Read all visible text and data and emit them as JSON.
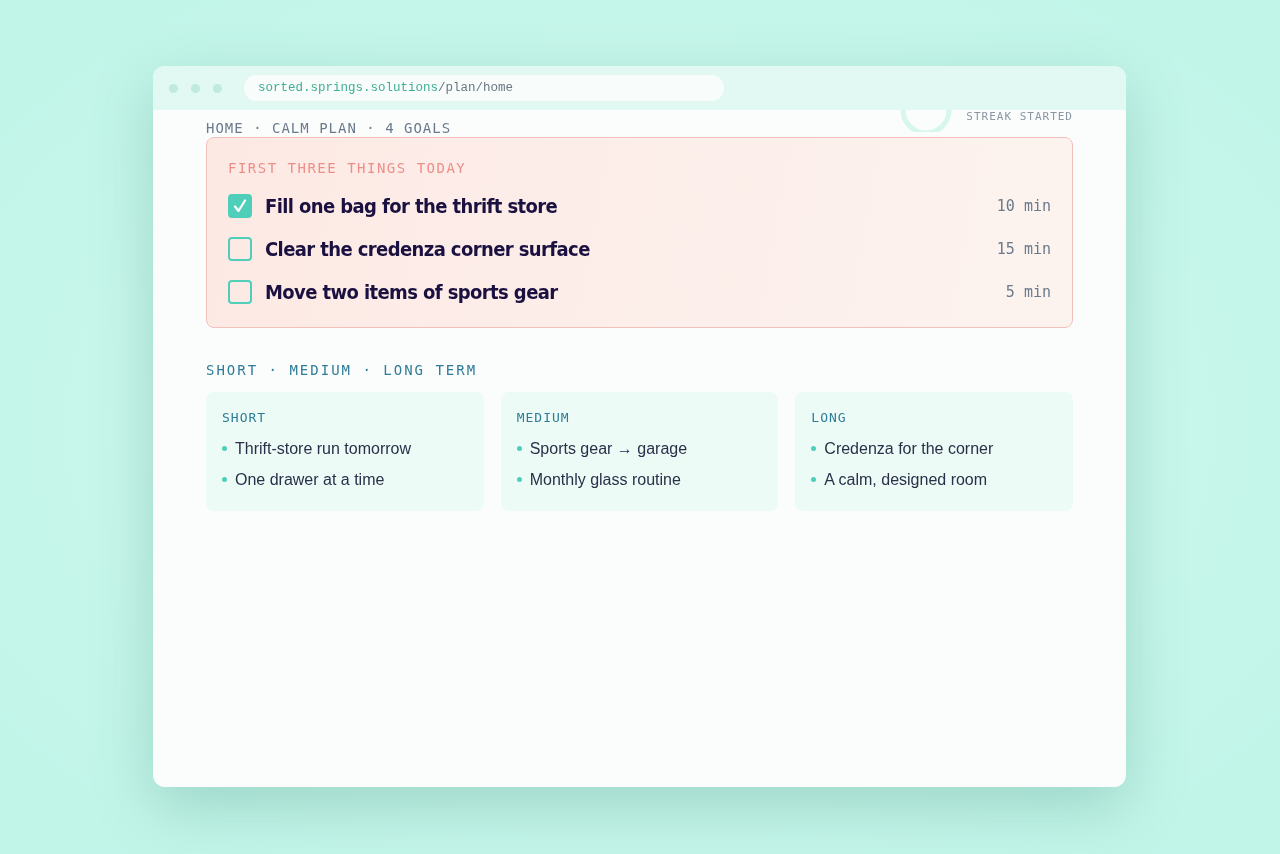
{
  "browser": {
    "url_host": "sorted.springs.solutions",
    "url_path": "/plan/home"
  },
  "header": {
    "breadcrumb": "HOME · CALM PLAN · 4 GOALS",
    "streak_label": "STREAK STARTED"
  },
  "today": {
    "title": "FIRST THREE THINGS TODAY",
    "tasks": [
      {
        "label": "Fill one bag for the thrift store",
        "duration": "10 min",
        "checked": true
      },
      {
        "label": "Clear the credenza corner surface",
        "duration": "15 min",
        "checked": false
      },
      {
        "label": "Move two items of sports gear",
        "duration": "5 min",
        "checked": false
      }
    ]
  },
  "terms": {
    "title": "SHORT · MEDIUM · LONG TERM",
    "columns": [
      {
        "heading": "SHORT",
        "items": [
          "Thrift-store run tomorrow",
          "One drawer at a time"
        ]
      },
      {
        "heading": "MEDIUM",
        "items": [
          "Sports gear → garage",
          "Monthly glass routine"
        ]
      },
      {
        "heading": "LONG",
        "items": [
          "Credenza for the corner",
          "A calm, designed room"
        ]
      }
    ]
  }
}
